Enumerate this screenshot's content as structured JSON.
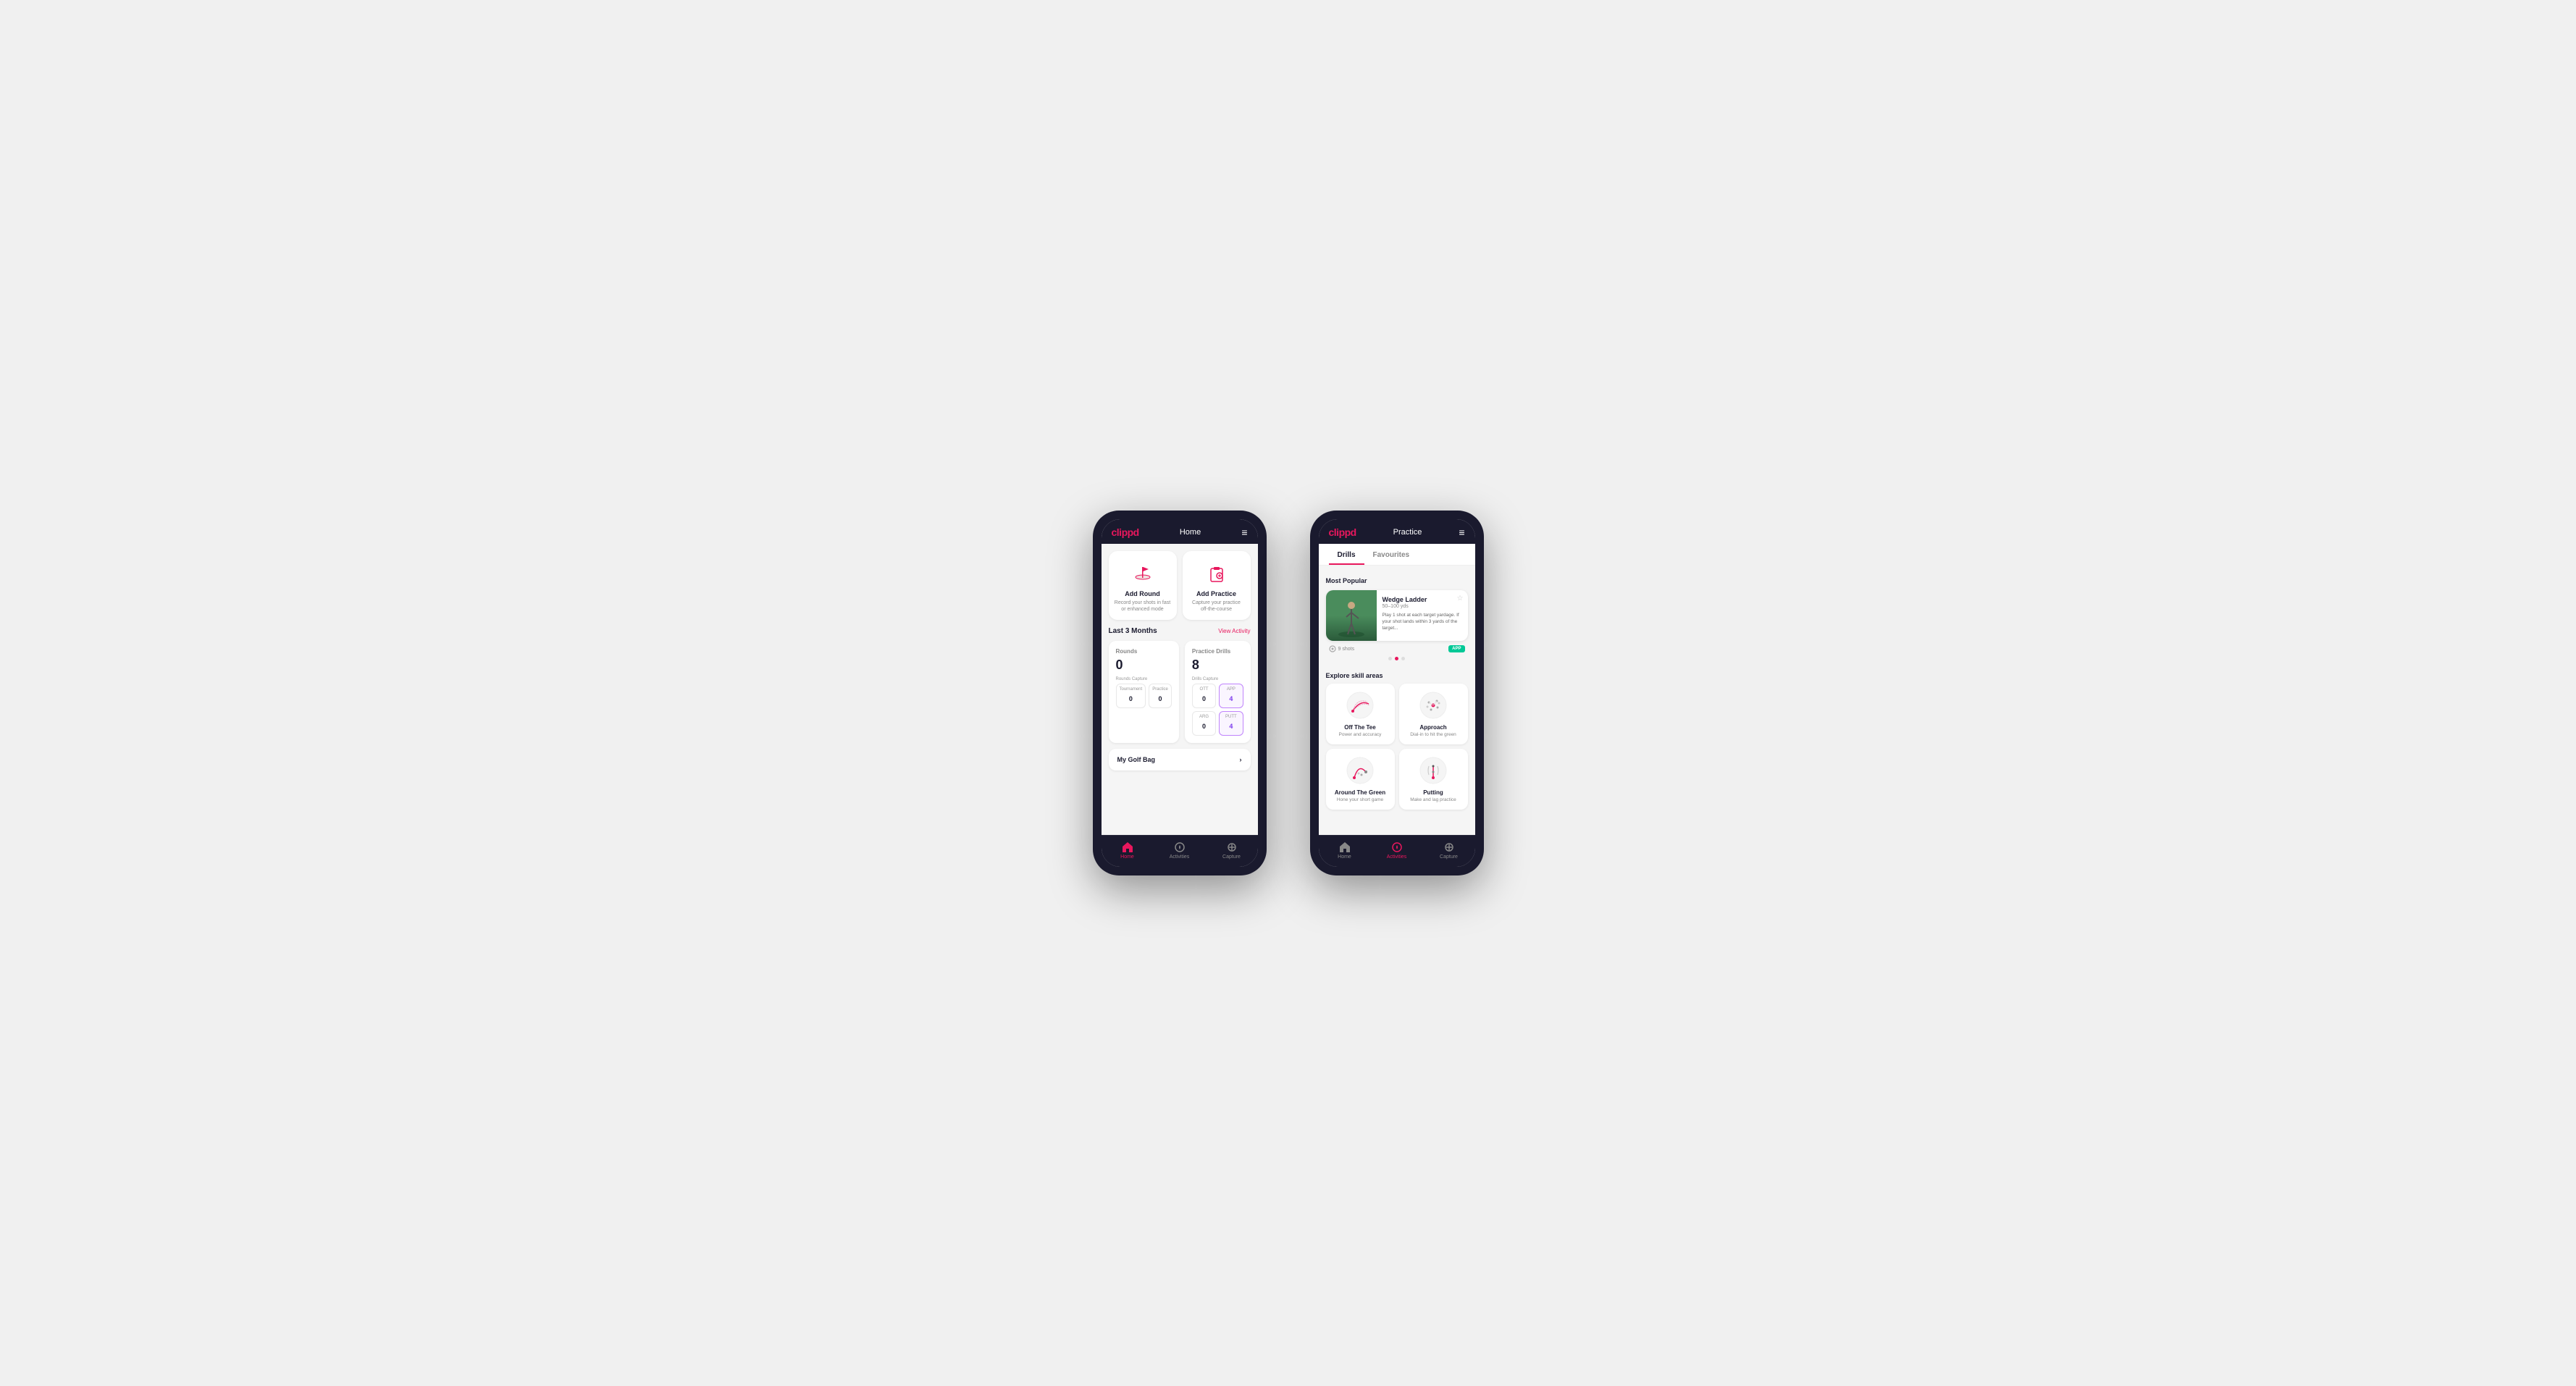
{
  "phone1": {
    "header": {
      "logo": "clippd",
      "title": "Home",
      "menu_icon": "≡"
    },
    "quick_actions": [
      {
        "id": "add-round",
        "icon": "flag",
        "title": "Add Round",
        "description": "Record your shots in fast or enhanced mode"
      },
      {
        "id": "add-practice",
        "icon": "clipboard",
        "title": "Add Practice",
        "description": "Capture your practice off-the-course"
      }
    ],
    "activity": {
      "section_title": "Last 3 Months",
      "view_link": "View Activity",
      "rounds": {
        "title": "Rounds",
        "capture_label": "Rounds Capture",
        "total": "0",
        "rows": [
          {
            "label": "Tournament",
            "value": "0"
          },
          {
            "label": "Practice",
            "value": "0"
          }
        ]
      },
      "drills": {
        "title": "Practice Drills",
        "capture_label": "Drills Capture",
        "total": "8",
        "cols": [
          {
            "label": "OTT",
            "value": "0"
          },
          {
            "label": "APP",
            "value": "4",
            "highlighted": true
          },
          {
            "label": "ARG",
            "value": "0"
          },
          {
            "label": "PUTT",
            "value": "4",
            "highlighted": true
          }
        ]
      }
    },
    "golf_bag": {
      "label": "My Golf Bag"
    },
    "nav": [
      {
        "id": "home",
        "icon": "🏠",
        "label": "Home",
        "active": true
      },
      {
        "id": "activities",
        "icon": "⛳",
        "label": "Activities",
        "active": false
      },
      {
        "id": "capture",
        "icon": "➕",
        "label": "Capture",
        "active": false
      }
    ]
  },
  "phone2": {
    "header": {
      "logo": "clippd",
      "title": "Practice",
      "menu_icon": "≡"
    },
    "tabs": [
      {
        "id": "drills",
        "label": "Drills",
        "active": true
      },
      {
        "id": "favourites",
        "label": "Favourites",
        "active": false
      }
    ],
    "featured": {
      "section_label": "Most Popular",
      "card": {
        "title": "Wedge Ladder",
        "yds": "50–100 yds",
        "description": "Play 1 shot at each target yardage. If your shot lands within 3 yards of the target...",
        "shots": "9 shots",
        "badge": "APP"
      },
      "dots": [
        {
          "active": false
        },
        {
          "active": true
        },
        {
          "active": false
        }
      ]
    },
    "skills": {
      "section_label": "Explore skill areas",
      "items": [
        {
          "id": "off-the-tee",
          "title": "Off The Tee",
          "description": "Power and accuracy",
          "icon": "tee"
        },
        {
          "id": "approach",
          "title": "Approach",
          "description": "Dial-in to hit the green",
          "icon": "approach"
        },
        {
          "id": "around-the-green",
          "title": "Around The Green",
          "description": "Hone your short game",
          "icon": "atg"
        },
        {
          "id": "putting",
          "title": "Putting",
          "description": "Make and lag practice",
          "icon": "putt"
        }
      ]
    },
    "nav": [
      {
        "id": "home",
        "icon": "🏠",
        "label": "Home",
        "active": false
      },
      {
        "id": "activities",
        "icon": "⛳",
        "label": "Activities",
        "active": true
      },
      {
        "id": "capture",
        "icon": "➕",
        "label": "Capture",
        "active": false
      }
    ]
  }
}
